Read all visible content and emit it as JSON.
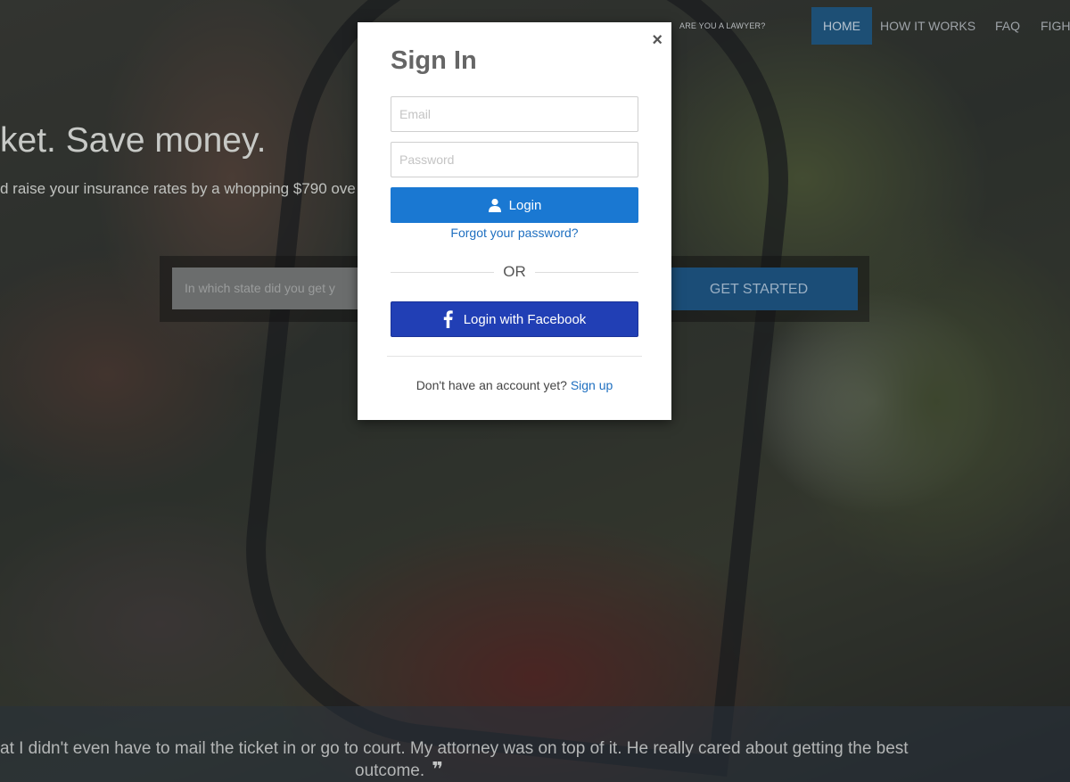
{
  "nav": {
    "lawyer_link": "ARE YOU A LAWYER?",
    "items": [
      {
        "label": "HOME",
        "active": true
      },
      {
        "label": "HOW IT WORKS",
        "active": false
      },
      {
        "label": "FAQ",
        "active": false
      },
      {
        "label": "FIGHT",
        "active": false
      }
    ]
  },
  "hero": {
    "title": "ket. Save money.",
    "subtitle": "d raise your insurance rates by a whopping $790 ove",
    "search_placeholder": "In which state did you get y",
    "cta_label": "GET STARTED"
  },
  "testimonial": {
    "line1": "at I didn't even have to mail the ticket in or go to court. My attorney was on top of it. He really cared about getting the best",
    "line2": "outcome.",
    "quote_mark": "❞"
  },
  "modal": {
    "title": "Sign In",
    "close_icon": "×",
    "email_placeholder": "Email",
    "password_placeholder": "Password",
    "login_label": "Login",
    "forgot_label": "Forgot your password?",
    "or_label": "OR",
    "facebook_label": "Login with Facebook",
    "signup_prompt": "Don't have an account yet?",
    "signup_link": "Sign up"
  },
  "colors": {
    "login_button": "#1a78d2",
    "facebook_button": "#213fb5",
    "link": "#1e6fc0",
    "nav_active": "#1d4f75"
  }
}
